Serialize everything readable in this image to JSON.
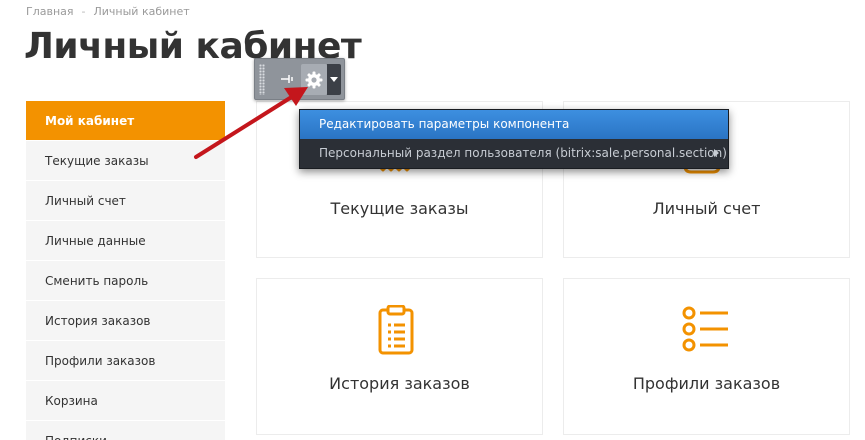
{
  "breadcrumb": {
    "home": "Главная",
    "separator": "-",
    "current": "Личный кабинет"
  },
  "page_title": "Личный кабинет",
  "sidebar": {
    "items": [
      {
        "label": "Мой кабинет",
        "active": true
      },
      {
        "label": "Текущие заказы"
      },
      {
        "label": "Личный счет"
      },
      {
        "label": "Личные данные"
      },
      {
        "label": "Сменить пароль"
      },
      {
        "label": "История заказов"
      },
      {
        "label": "Профили заказов"
      },
      {
        "label": "Корзина"
      },
      {
        "label": "Подписки"
      }
    ]
  },
  "cards": [
    {
      "label": "Текущие заказы",
      "icon": "current-orders-icon"
    },
    {
      "label": "Личный счет",
      "icon": "wallet-icon"
    },
    {
      "label": "История заказов",
      "icon": "clipboard-icon"
    },
    {
      "label": "Профили заказов",
      "icon": "list-icon"
    }
  ],
  "toolbar": {
    "pin_icon": "pin-icon",
    "settings_icon": "gear-icon",
    "dropdown_icon": "chevron-down-icon"
  },
  "context_menu": {
    "items": [
      {
        "label": "Редактировать параметры компонента"
      },
      {
        "label": "Персональный раздел пользователя (bitrix:sale.personal.section)"
      }
    ]
  },
  "colors": {
    "accent": "#f39200",
    "menu_bg": "#2b2f36",
    "menu_highlight": "#2f7fd0",
    "toolbar_bg": "#8f949b",
    "arrow": "#c4161c"
  }
}
